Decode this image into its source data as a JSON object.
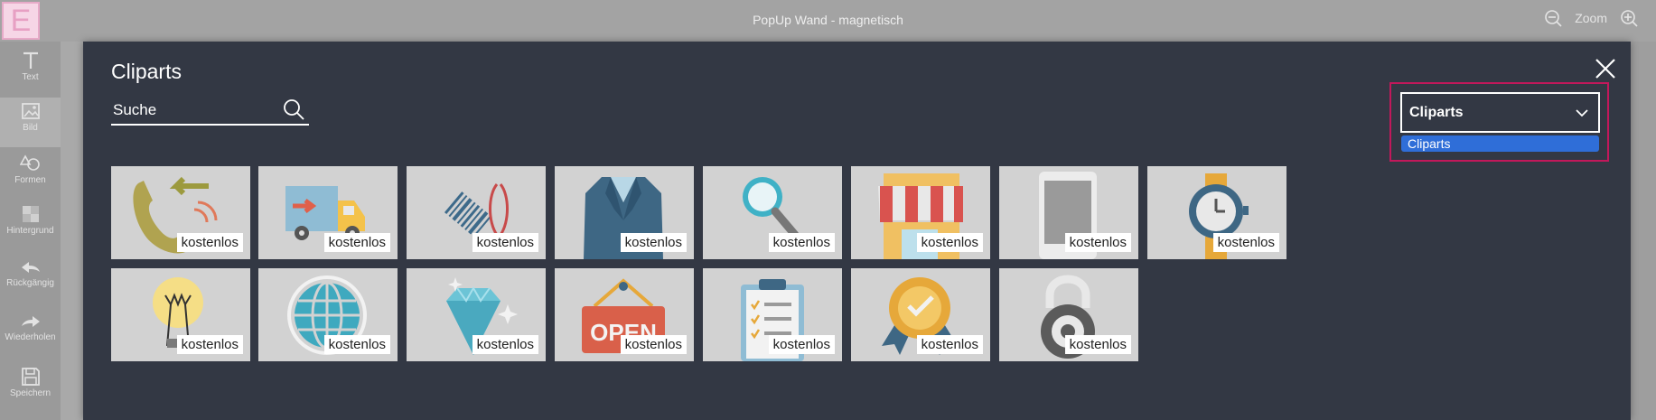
{
  "app": {
    "logo_letter": "E",
    "title": "PopUp Wand - magnetisch",
    "zoom_label": "Zoom"
  },
  "sidebar": {
    "items": [
      {
        "label": "Text",
        "icon": "text-icon"
      },
      {
        "label": "Bild",
        "icon": "image-icon"
      },
      {
        "label": "Formen",
        "icon": "shapes-icon"
      },
      {
        "label": "Hintergrund",
        "icon": "background-icon"
      },
      {
        "label": "Rückgängig",
        "icon": "undo-icon"
      },
      {
        "label": "Wiederholen",
        "icon": "redo-icon"
      },
      {
        "label": "Speichern",
        "icon": "save-icon"
      }
    ]
  },
  "modal": {
    "title": "Cliparts",
    "search_placeholder": "Suche",
    "dropdown_selected": "Cliparts",
    "dropdown_option": "Cliparts",
    "tiles": [
      {
        "icon": "phone-icon",
        "label": "kostenlos"
      },
      {
        "icon": "delivery-truck-icon",
        "label": "kostenlos"
      },
      {
        "icon": "barcode-scan-icon",
        "label": "kostenlos"
      },
      {
        "icon": "suit-jacket-icon",
        "label": "kostenlos"
      },
      {
        "icon": "magnifier-icon",
        "label": "kostenlos"
      },
      {
        "icon": "shop-icon",
        "label": "kostenlos"
      },
      {
        "icon": "tablet-icon",
        "label": "kostenlos"
      },
      {
        "icon": "wristwatch-icon",
        "label": "kostenlos"
      },
      {
        "icon": "lightbulb-icon",
        "label": "kostenlos"
      },
      {
        "icon": "globe-icon",
        "label": "kostenlos"
      },
      {
        "icon": "diamond-icon",
        "label": "kostenlos"
      },
      {
        "icon": "open-sign-icon",
        "label": "kostenlos"
      },
      {
        "icon": "clipboard-icon",
        "label": "kostenlos"
      },
      {
        "icon": "award-badge-icon",
        "label": "kostenlos"
      },
      {
        "icon": "padlock-icon",
        "label": "kostenlos"
      }
    ],
    "open_sign_text": "OPEN"
  },
  "colors": {
    "modal_bg": "#333844",
    "tile_bg": "#d2d2d2",
    "highlight": "#c2185b",
    "option_selected": "#2f6ed8"
  }
}
